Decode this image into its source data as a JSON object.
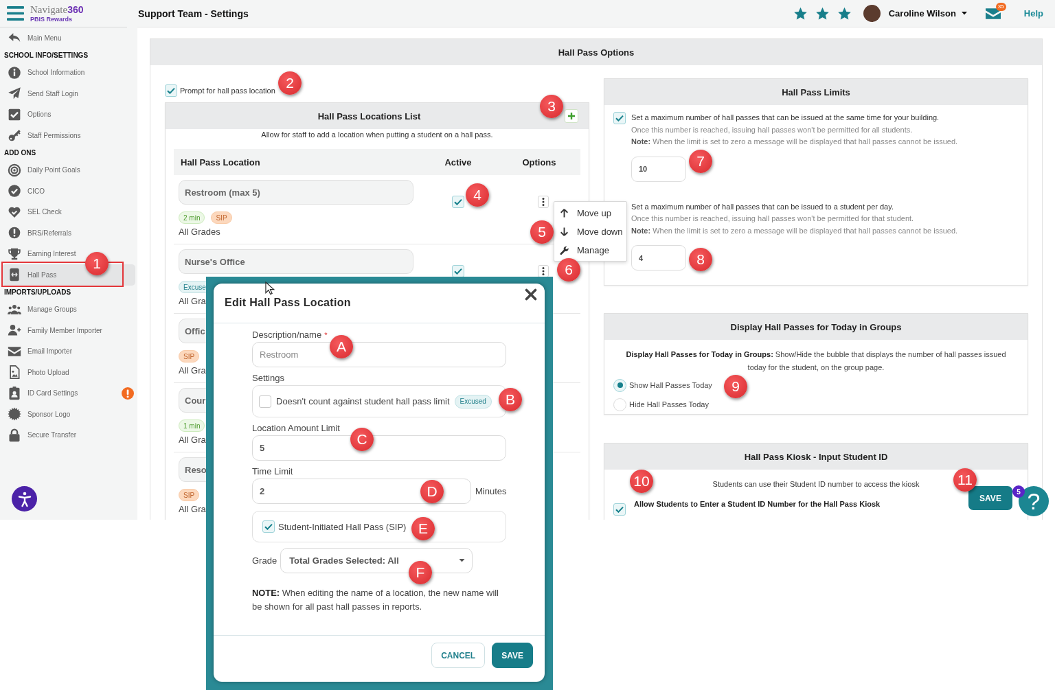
{
  "sidebar": {
    "logo": {
      "wordmark": "Navigate**360**",
      "product": "PBIS Rewards"
    },
    "back_link": "Main Menu",
    "sections": [
      {
        "title": "SCHOOL INFO/SETTINGS",
        "items": [
          {
            "label": "School Information",
            "selected": false,
            "alert": false
          },
          {
            "label": "Send Staff Login",
            "selected": false,
            "alert": false
          },
          {
            "label": "Options",
            "selected": false,
            "alert": false
          },
          {
            "label": "Staff Permissions",
            "selected": false,
            "alert": false
          }
        ]
      },
      {
        "title": "ADD ONS",
        "items": [
          {
            "label": "Daily Point Goals",
            "selected": false,
            "alert": false
          },
          {
            "label": "CICO",
            "selected": false,
            "alert": false
          },
          {
            "label": "SEL Check",
            "selected": false,
            "alert": false
          },
          {
            "label": "BRS/Referrals",
            "selected": false,
            "alert": false
          },
          {
            "label": "Earning Interest",
            "selected": false,
            "alert": false
          },
          {
            "label": "Hall Pass",
            "selected": true,
            "alert": false
          }
        ]
      },
      {
        "title": "IMPORTS/UPLOADS",
        "items": [
          {
            "label": "Manage Groups",
            "selected": false,
            "alert": false
          },
          {
            "label": "Family Member Importer",
            "selected": false,
            "alert": false
          },
          {
            "label": "Email Importer",
            "selected": false,
            "alert": false
          },
          {
            "label": "Photo Upload",
            "selected": false,
            "alert": false
          },
          {
            "label": "ID Card Settings",
            "selected": false,
            "alert": true
          },
          {
            "label": "Sponsor Logo",
            "selected": false,
            "alert": false
          },
          {
            "label": "Secure Transfer",
            "selected": false,
            "alert": false
          }
        ]
      }
    ]
  },
  "header": {
    "title": "Support Team - Settings",
    "rating": {
      "stars": 3
    },
    "user_name": "Caroline Wilson",
    "unread_count": "35",
    "help_link": "Help"
  },
  "hall_pass_options": {
    "title": "Hall Pass Options",
    "prompt_location": {
      "label": "Prompt for hall pass location",
      "checked": true
    },
    "locations_list": {
      "title": "Hall Pass Locations List",
      "subtitle": "Allow for staff to add a location when putting a student on a hall pass.",
      "columns": [
        "Hall Pass Location",
        "Active",
        "Options"
      ],
      "rows": [
        {
          "name": "Restroom (max 5)",
          "tags": [
            {
              "label": "2 min",
              "kind": "time"
            },
            {
              "label": "SIP",
              "kind": "sip"
            }
          ],
          "grades": "All Grades",
          "active": true,
          "menu": {
            "items": [
              "Move up",
              "Move down",
              "Manage"
            ]
          }
        },
        {
          "name": "Nurse's Office",
          "tags": [
            {
              "label": "Excuse",
              "kind": "excused"
            }
          ],
          "grades": "All Gra",
          "active": true
        },
        {
          "name": "Offic",
          "tags": [
            {
              "label": "SIP",
              "kind": "sip"
            }
          ],
          "grades": "All Gra"
        },
        {
          "name": "Cour",
          "tags": [
            {
              "label": "1 min",
              "kind": "time"
            }
          ],
          "grades": "All Gra"
        },
        {
          "name": "Reso",
          "tags": [
            {
              "label": "SIP",
              "kind": "sip"
            }
          ],
          "grades": "All Gra"
        }
      ]
    },
    "limits": {
      "title": "Hall Pass Limits",
      "rules": [
        {
          "checked": true,
          "text": "Set a maximum number of hall passes that can be issued at the same time for your building.",
          "detail": "Once this number is reached, issuing hall passes won't be permitted for all students.",
          "note": "**Note:** When the limit is set to zero a message will be displayed that hall passes cannot be issued.",
          "value": "10"
        },
        {
          "text": "Set a maximum number of hall passes that can be issued to a student per day.",
          "detail": "Once this number is reached, issuing hall passes won't be permitted for that student.",
          "note": "**Note:** When the limit is set to zero a message will be displayed that hall passes cannot be issued.",
          "value": "4"
        }
      ]
    },
    "display_groups": {
      "title": "Display Hall Passes for Today in Groups",
      "description": "**Display Hall Passes for Today in Groups:** Show/Hide the bubble that displays the number of hall passes issued today for the student, on the group page.",
      "options": [
        {
          "label": "Show Hall Passes Today",
          "selected": true
        },
        {
          "label": "Hide Hall Passes Today",
          "selected": false
        }
      ]
    },
    "kiosk": {
      "title": "Hall Pass Kiosk - Input Student ID",
      "description": "Students can use their Student ID number to access the kiosk",
      "allow_student_id": {
        "label": "Allow Students to Enter a Student ID Number for the Hall Pass Kiosk",
        "checked": true
      }
    }
  },
  "save_button": "SAVE",
  "help_button": {
    "label": "?",
    "badge": "5"
  },
  "dialog": {
    "title": "Edit Hall Pass Location",
    "name_field": {
      "label": "Description/name",
      "required_mark": "*",
      "placeholder": "Restroom"
    },
    "settings": {
      "label": "Settings",
      "excused_option": {
        "label": "Doesn't count against student hall pass limit",
        "checked": false,
        "tag": "Excused"
      }
    },
    "amount_limit": {
      "label": "Location Amount Limit",
      "value": "5"
    },
    "time_limit": {
      "label": "Time Limit",
      "value": "2",
      "unit": "Minutes"
    },
    "sip_option": {
      "label": "Student-Initiated Hall Pass (SIP)",
      "checked": true
    },
    "grade": {
      "label": "Grade",
      "value": "Total Grades Selected: All"
    },
    "note": "**NOTE:** When editing the name of a location, the new name will be shown for all past hall passes in reports.",
    "buttons": [
      {
        "label": "CANCEL",
        "kind": "secondary"
      },
      {
        "label": "SAVE",
        "kind": "primary"
      }
    ]
  },
  "annotations": [
    {
      "label": "1",
      "outline": true
    },
    {
      "label": "2",
      "outline": false
    },
    {
      "label": "3",
      "outline": false
    },
    {
      "label": "4",
      "outline": false
    },
    {
      "label": "5",
      "outline": false
    },
    {
      "label": "6",
      "outline": false
    },
    {
      "label": "7",
      "outline": false
    },
    {
      "label": "8",
      "outline": false
    },
    {
      "label": "9",
      "outline": false
    },
    {
      "label": "10",
      "outline": false
    },
    {
      "label": "11",
      "outline": false
    },
    {
      "label": "A",
      "outline": false
    },
    {
      "label": "B",
      "outline": false
    },
    {
      "label": "C",
      "outline": false
    },
    {
      "label": "D",
      "outline": false
    },
    {
      "label": "E",
      "outline": false
    },
    {
      "label": "F",
      "outline": false
    }
  ]
}
